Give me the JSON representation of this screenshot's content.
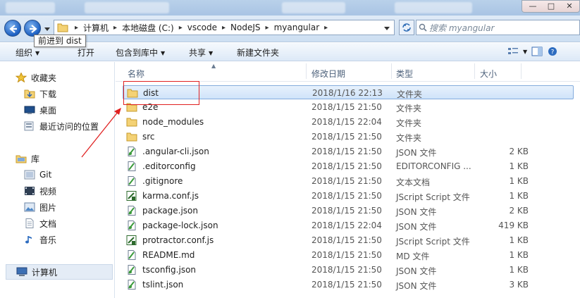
{
  "window": {
    "control_min": "—",
    "control_max": "□",
    "control_close": "✕"
  },
  "nav": {
    "breadcrumbs": [
      "计算机",
      "本地磁盘 (C:)",
      "vscode",
      "NodeJS",
      "myangular"
    ],
    "search_placeholder": "搜索 myangular",
    "tooltip": "前进到 dist"
  },
  "commands": {
    "organize": "组织",
    "open": "打开",
    "include_in_library": "包含到库中",
    "share": "共享",
    "new_folder": "新建文件夹"
  },
  "sidebar": {
    "favorites": "收藏夹",
    "favorites_items": [
      "下载",
      "桌面",
      "最近访问的位置"
    ],
    "libraries": "库",
    "library_items": [
      "Git",
      "视频",
      "图片",
      "文档",
      "音乐"
    ],
    "computer": "计算机"
  },
  "columns": {
    "name": "名称",
    "date": "修改日期",
    "type": "类型",
    "size": "大小"
  },
  "files": [
    {
      "name": "dist",
      "date": "2018/1/16 22:13",
      "type": "文件夹",
      "size": "",
      "icon": "folder-icon"
    },
    {
      "name": "e2e",
      "date": "2018/1/15 21:50",
      "type": "文件夹",
      "size": "",
      "icon": "folder-icon"
    },
    {
      "name": "node_modules",
      "date": "2018/1/15 22:04",
      "type": "文件夹",
      "size": "",
      "icon": "folder-icon"
    },
    {
      "name": "src",
      "date": "2018/1/15 21:50",
      "type": "文件夹",
      "size": "",
      "icon": "folder-icon"
    },
    {
      "name": ".angular-cli.json",
      "date": "2018/1/15 21:50",
      "type": "JSON 文件",
      "size": "2 KB",
      "icon": "json-file-icon"
    },
    {
      "name": ".editorconfig",
      "date": "2018/1/15 21:50",
      "type": "EDITORCONFIG ...",
      "size": "1 KB",
      "icon": "file-icon"
    },
    {
      "name": ".gitignore",
      "date": "2018/1/15 21:50",
      "type": "文本文档",
      "size": "1 KB",
      "icon": "file-icon"
    },
    {
      "name": "karma.conf.js",
      "date": "2018/1/15 21:50",
      "type": "JScript Script 文件",
      "size": "1 KB",
      "icon": "js-file-icon"
    },
    {
      "name": "package.json",
      "date": "2018/1/15 21:50",
      "type": "JSON 文件",
      "size": "2 KB",
      "icon": "json-file-icon"
    },
    {
      "name": "package-lock.json",
      "date": "2018/1/15 22:04",
      "type": "JSON 文件",
      "size": "419 KB",
      "icon": "json-file-icon"
    },
    {
      "name": "protractor.conf.js",
      "date": "2018/1/15 21:50",
      "type": "JScript Script 文件",
      "size": "1 KB",
      "icon": "js-file-icon"
    },
    {
      "name": "README.md",
      "date": "2018/1/15 21:50",
      "type": "MD 文件",
      "size": "1 KB",
      "icon": "file-icon"
    },
    {
      "name": "tsconfig.json",
      "date": "2018/1/15 21:50",
      "type": "JSON 文件",
      "size": "1 KB",
      "icon": "json-file-icon"
    },
    {
      "name": "tslint.json",
      "date": "2018/1/15 21:50",
      "type": "JSON 文件",
      "size": "3 KB",
      "icon": "json-file-icon"
    }
  ],
  "colors": {
    "annotation": "#e02020",
    "selection": "#cfe3fa"
  }
}
